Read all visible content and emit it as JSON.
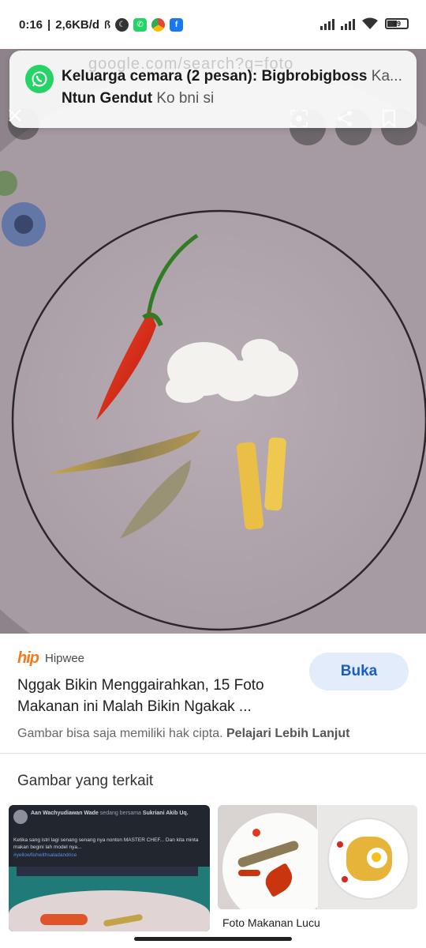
{
  "status_bar": {
    "time": "0:16",
    "speed": "2,6KB/d",
    "battery": "49"
  },
  "browser_ghost": {
    "url": "google.com/search?q=foto"
  },
  "notification": {
    "app_icon": "whatsapp-icon",
    "title": "Keluarga cemara (2 pesan): Bigbrobigboss",
    "message_preview": "Ka...",
    "line2_bold": "Ntun Gendut",
    "line2_msg": "Ko bni si"
  },
  "image_controls": {
    "close_icon": "close-icon",
    "lens_icon": "lens-icon",
    "share_icon": "share-icon",
    "bookmark_icon": "bookmark-icon"
  },
  "result": {
    "source_logo": "hip",
    "source_name": "Hipwee",
    "title": "Nggak Bikin Menggairahkan, 15 Foto Makanan ini Malah Bikin Ngakak ...",
    "open_button": "Buka",
    "copyright_text": "Gambar bisa saja memiliki hak cipta.",
    "learn_more": "Pelajari Lebih Lanjut"
  },
  "related": {
    "heading": "Gambar yang terkait",
    "items": [
      {
        "post_author": "Aan Wachyudiawan Wade",
        "post_with": "sedang bersama",
        "post_tagged": "Sukriani Akib Uq.",
        "post_text": "Ketika sang istri lagi senang senang nya nonton MASTER CHEF... Dan kita minta makan begini lah model nya...",
        "post_hashtag": "#yellowfishwithsaladandrice"
      },
      {
        "caption": "Foto Makanan Lucu"
      }
    ]
  },
  "colors": {
    "accent": "#1a5dc8",
    "button_bg": "#e3ecfa",
    "whatsapp": "#25d366",
    "hipwee": "#f07c1e"
  }
}
